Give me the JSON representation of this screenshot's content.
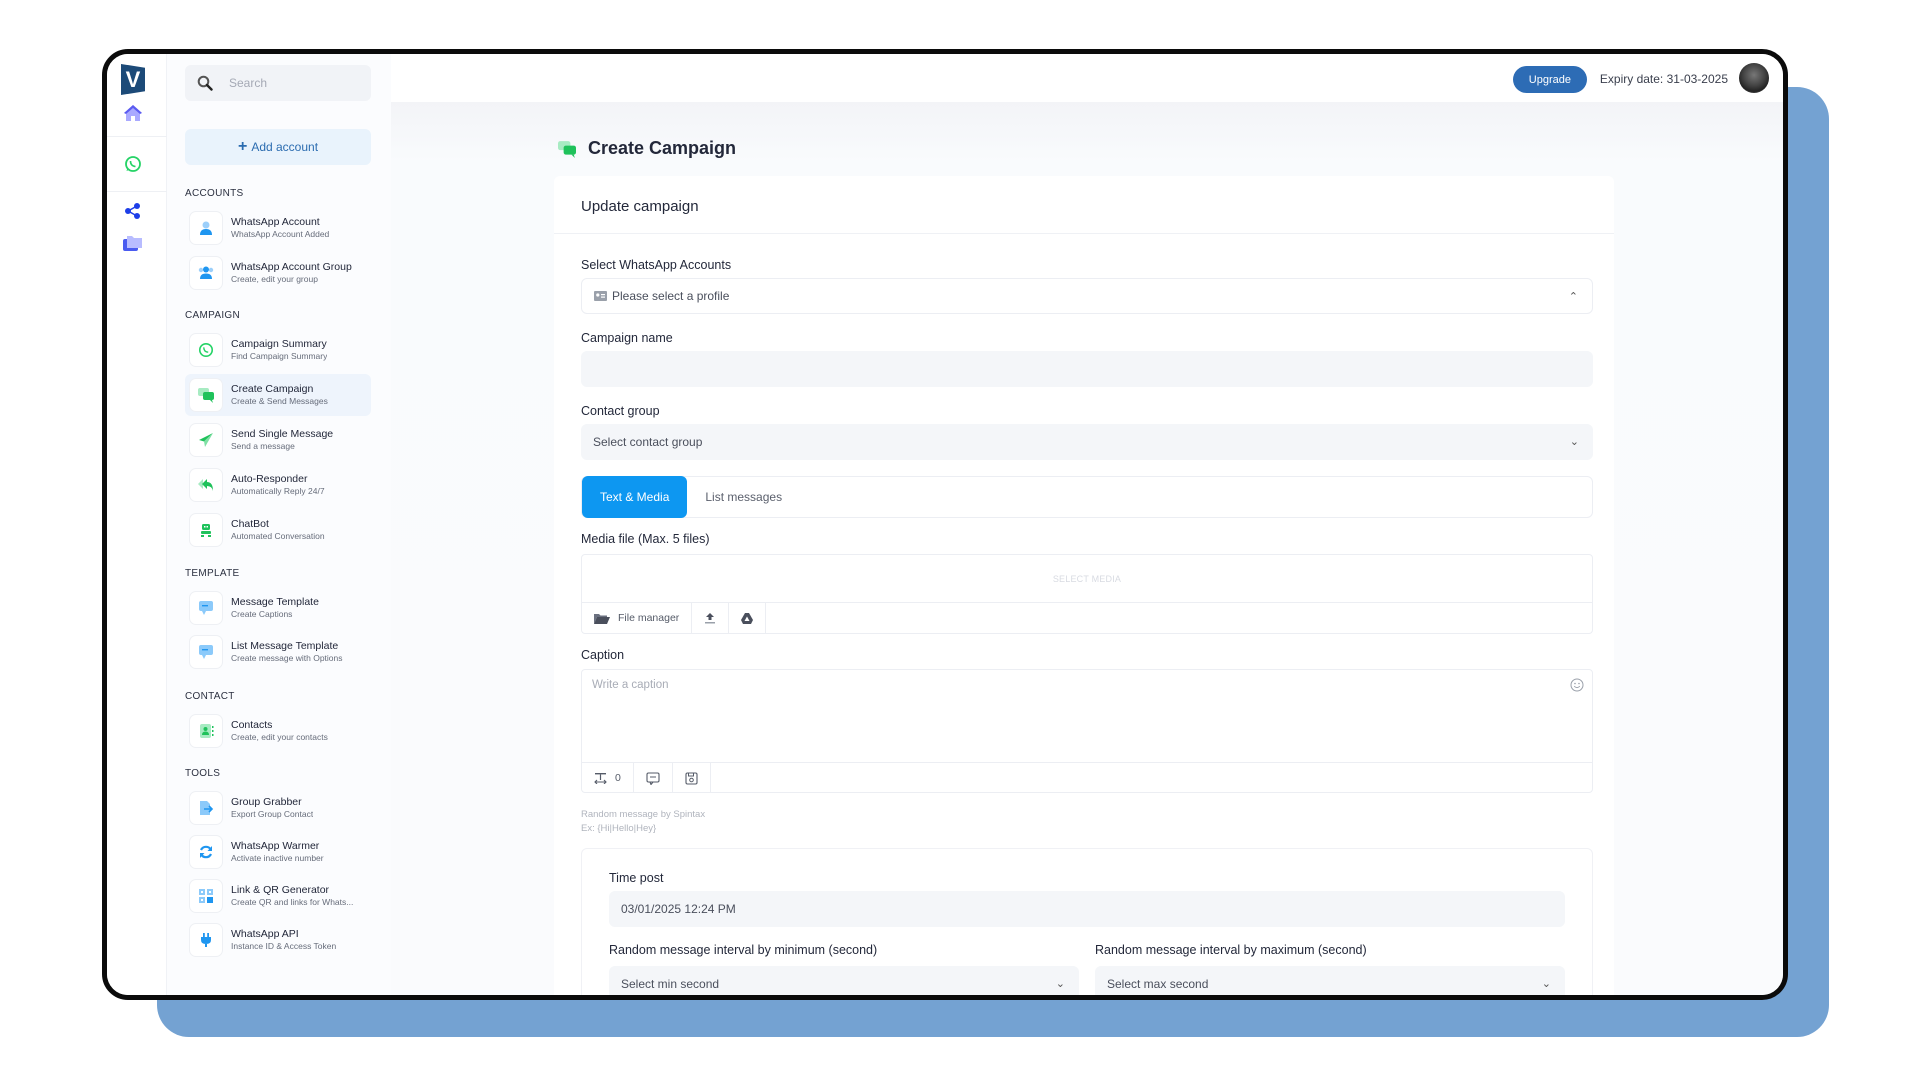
{
  "rail": {
    "logo": "V",
    "icons": [
      "home-icon",
      "whatsapp-icon",
      "share-icon",
      "folder-icon"
    ]
  },
  "sidebar": {
    "search_placeholder": "Search",
    "add_account": "Add account",
    "sections": {
      "accounts": "ACCOUNTS",
      "campaign": "CAMPAIGN",
      "template": "TEMPLATE",
      "contact": "CONTACT",
      "tools": "TOOLS"
    },
    "items": [
      {
        "title": "WhatsApp Account",
        "sub": "WhatsApp Account Added"
      },
      {
        "title": "WhatsApp Account Group",
        "sub": "Create, edit your group"
      },
      {
        "title": "Campaign Summary",
        "sub": "Find Campaign Summary"
      },
      {
        "title": "Create Campaign",
        "sub": "Create & Send Messages"
      },
      {
        "title": "Send Single Message",
        "sub": "Send a message"
      },
      {
        "title": "Auto-Responder",
        "sub": "Automatically Reply 24/7"
      },
      {
        "title": "ChatBot",
        "sub": "Automated Conversation"
      },
      {
        "title": "Message Template",
        "sub": "Create Captions"
      },
      {
        "title": "List Message Template",
        "sub": "Create message with Options"
      },
      {
        "title": "Contacts",
        "sub": "Create, edit your contacts"
      },
      {
        "title": "Group Grabber",
        "sub": "Export Group Contact"
      },
      {
        "title": "WhatsApp Warmer",
        "sub": "Activate inactive number"
      },
      {
        "title": "Link & QR Generator",
        "sub": "Create QR and links for Whats..."
      },
      {
        "title": "WhatsApp API",
        "sub": "Instance ID & Access Token"
      }
    ]
  },
  "topbar": {
    "upgrade": "Upgrade",
    "expiry": "Expiry date: 31-03-2025"
  },
  "main": {
    "page_title": "Create Campaign",
    "card_title": "Update campaign",
    "accounts_label": "Select WhatsApp Accounts",
    "accounts_placeholder": "Please select a profile",
    "name_label": "Campaign name",
    "name_value": "",
    "group_label": "Contact group",
    "group_placeholder": "Select contact group",
    "tabs": [
      "Text & Media",
      "List messages"
    ],
    "media_label": "Media file (Max. 5 files)",
    "media_drop": "SELECT MEDIA",
    "file_manager": "File manager",
    "caption_label": "Caption",
    "caption_placeholder": "Write a caption",
    "caption_count": "0",
    "hint1": "Random message by Spintax",
    "hint2": "Ex: {Hi|Hello|Hey}",
    "time_label": "Time post",
    "time_value": "03/01/2025 12:24 PM",
    "min_label": "Random message interval by minimum (second)",
    "min_placeholder": "Select min second",
    "max_label": "Random message interval by maximum (second)",
    "max_placeholder": "Select max second"
  }
}
